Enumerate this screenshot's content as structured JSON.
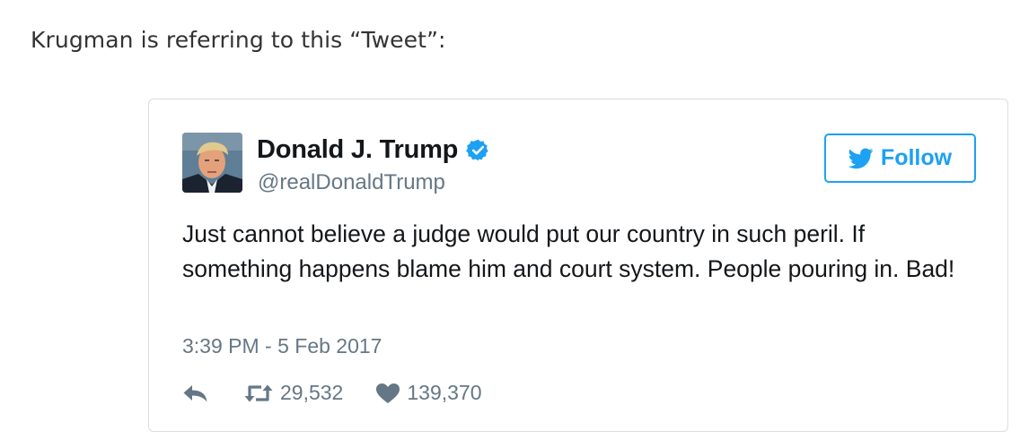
{
  "intro_text": "Krugman is referring to this “Tweet”:",
  "tweet": {
    "author": {
      "display_name": "Donald J. Trump",
      "handle": "@realDonaldTrump",
      "verified": true
    },
    "follow_label": "Follow",
    "text": "Just cannot believe a judge would put our country in such peril. If something happens blame him and court system. People pouring in. Bad!",
    "timestamp": "3:39 PM - 5 Feb 2017",
    "retweet_count": "29,532",
    "like_count": "139,370"
  },
  "colors": {
    "twitter_blue": "#1da1f2",
    "secondary_text": "#657786",
    "primary_text": "#14171a",
    "card_border": "#d8dee3"
  },
  "icons": {
    "verified": "verified-badge-icon",
    "follow": "twitter-bird-icon",
    "reply": "reply-arrow-icon",
    "retweet": "retweet-icon",
    "like": "heart-icon"
  }
}
